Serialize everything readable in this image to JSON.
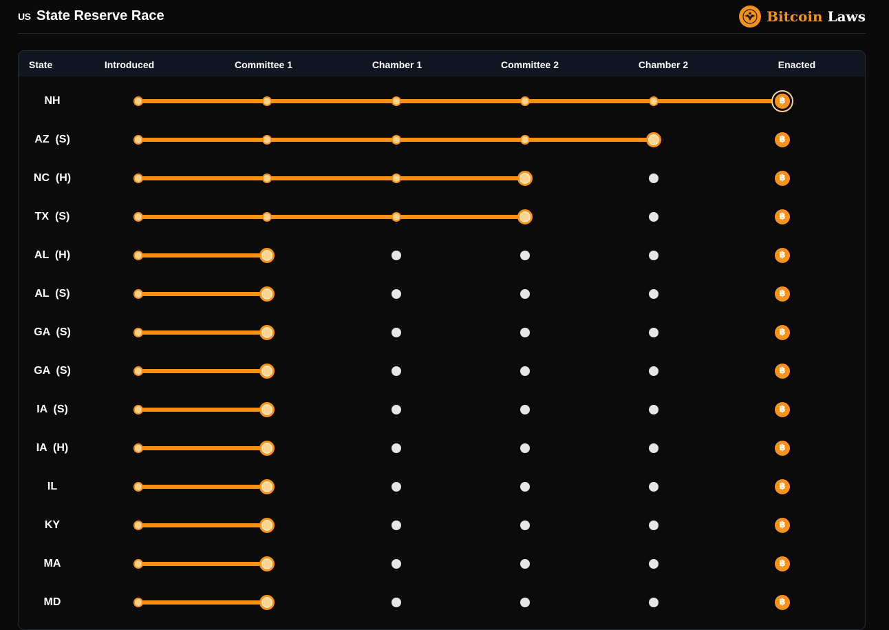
{
  "header": {
    "flag_text": "US",
    "title": "State Reserve Race",
    "brand_primary": "Bitcoin",
    "brand_secondary": "Laws"
  },
  "table": {
    "columns": [
      "State",
      "Introduced",
      "Committee 1",
      "Chamber 1",
      "Committee 2",
      "Chamber 2",
      "Enacted"
    ],
    "rows": [
      {
        "state": "NH",
        "reached_stage": 5
      },
      {
        "state": "AZ  (S)",
        "reached_stage": 4
      },
      {
        "state": "NC  (H)",
        "reached_stage": 3
      },
      {
        "state": "TX  (S)",
        "reached_stage": 3
      },
      {
        "state": "AL  (H)",
        "reached_stage": 1
      },
      {
        "state": "AL  (S)",
        "reached_stage": 1
      },
      {
        "state": "GA  (S)",
        "reached_stage": 1
      },
      {
        "state": "GA  (S)",
        "reached_stage": 1
      },
      {
        "state": "IA  (S)",
        "reached_stage": 1
      },
      {
        "state": "IA  (H)",
        "reached_stage": 1
      },
      {
        "state": "IL",
        "reached_stage": 1
      },
      {
        "state": "KY",
        "reached_stage": 1
      },
      {
        "state": "MA",
        "reached_stage": 1
      },
      {
        "state": "MD",
        "reached_stage": 1
      }
    ]
  },
  "icons": {
    "flag": "us-flag-icon",
    "brand": "eagle-seal-icon",
    "enacted_marker": "bitcoin-coin-icon"
  },
  "colors": {
    "accent": "#f7931a",
    "pending": "#e6e6e6",
    "background": "#0a0a0a",
    "table_header": "#111722"
  }
}
